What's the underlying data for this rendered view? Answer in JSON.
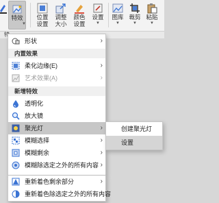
{
  "ribbon": {
    "buttons": [
      {
        "label": "",
        "icon": "outline-pen-icon"
      },
      {
        "label": "特效",
        "icon": "effects-icon"
      },
      {
        "label": "位置\n设置",
        "icon": "position-icon"
      },
      {
        "label": "调整\n大小",
        "icon": "resize-icon"
      },
      {
        "label": "颜色\n设置",
        "icon": "color-icon"
      },
      {
        "label": "设置",
        "icon": "settings-icon"
      },
      {
        "label": "图库",
        "icon": "gallery-icon"
      },
      {
        "label": "裁剪",
        "icon": "crop-icon"
      },
      {
        "label": "粘贴",
        "icon": "paste-icon"
      }
    ]
  },
  "strip": {
    "text": "特"
  },
  "menu": {
    "items": [
      {
        "type": "item",
        "label": "形状",
        "icon": "shape-icon",
        "arrow": true
      },
      {
        "type": "header",
        "label": "内置效果"
      },
      {
        "type": "item",
        "label": "柔化边缘(E)",
        "icon": "soft-edge-icon",
        "arrow": true
      },
      {
        "type": "item",
        "label": "艺术效果(A)",
        "icon": "art-effect-icon",
        "arrow": true,
        "disabled": true
      },
      {
        "type": "header",
        "label": "新增特效"
      },
      {
        "type": "item",
        "label": "透明化",
        "icon": "transparency-icon"
      },
      {
        "type": "item",
        "label": "放大镜",
        "icon": "magnifier-icon"
      },
      {
        "type": "item",
        "label": "聚光灯",
        "icon": "spotlight-icon",
        "arrow": true,
        "highlighted": true
      },
      {
        "type": "item",
        "label": "模糊选择",
        "icon": "blur-select-icon",
        "arrow": true
      },
      {
        "type": "item",
        "label": "模糊剩余",
        "icon": "blur-rest-icon",
        "arrow": true
      },
      {
        "type": "item",
        "label": "模糊除选定之外的所有内容",
        "icon": "blur-except-icon",
        "arrow": true
      },
      {
        "type": "item",
        "label": "重新着色剩余部分",
        "icon": "recolor-rest-icon",
        "arrow": true
      },
      {
        "type": "item",
        "label": "重新着色除选定之外的所有内容",
        "icon": "recolor-except-icon",
        "arrow": true
      }
    ]
  },
  "submenu": {
    "items": [
      {
        "label": "创建聚光灯"
      },
      {
        "label": "设置",
        "highlighted": true
      }
    ]
  }
}
